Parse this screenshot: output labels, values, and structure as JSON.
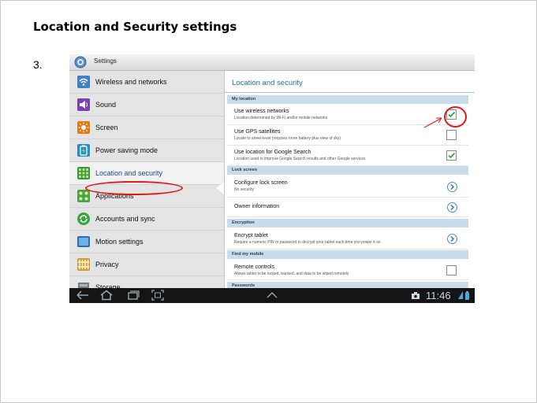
{
  "slide": {
    "title": "Location and Security settings",
    "step": "3."
  },
  "tablet": {
    "header_title": "Settings",
    "sidebar": {
      "items": [
        {
          "label": "Wireless and networks",
          "icon": "wifi-icon"
        },
        {
          "label": "Sound",
          "icon": "speaker-icon"
        },
        {
          "label": "Screen",
          "icon": "brightness-icon"
        },
        {
          "label": "Power saving mode",
          "icon": "power-saving-icon"
        },
        {
          "label": "Location and security",
          "icon": "location-security-icon"
        },
        {
          "label": "Applications",
          "icon": "applications-icon"
        },
        {
          "label": "Accounts and sync",
          "icon": "sync-icon"
        },
        {
          "label": "Motion settings",
          "icon": "motion-icon"
        },
        {
          "label": "Privacy",
          "icon": "privacy-icon"
        },
        {
          "label": "Storage",
          "icon": "storage-icon"
        }
      ],
      "active_index": 4
    },
    "panel": {
      "title": "Location and security",
      "sections": {
        "my_location": "My location",
        "lock_screen": "Lock screen",
        "encryption": "Encryption",
        "find_my_mobile": "Find my mobile",
        "passwords": "Passwords"
      },
      "rows": {
        "wireless": {
          "title": "Use wireless networks",
          "sub": "Location determined by Wi-Fi and/or mobile networks",
          "checked": true
        },
        "gps": {
          "title": "Use GPS satellites",
          "sub": "Locate to street-level (requires more battery plus view of sky)",
          "checked": false
        },
        "google": {
          "title": "Use location for Google Search",
          "sub": "Location used to improve Google Search results and other Google services",
          "checked": true
        },
        "configure_lock": {
          "title": "Configure lock screen",
          "sub": "No security"
        },
        "owner": {
          "title": "Owner information"
        },
        "encrypt": {
          "title": "Encrypt tablet",
          "sub": "Require a numeric PIN or password to decrypt your tablet each time you power it on"
        },
        "remote": {
          "title": "Remote controls",
          "sub": "Allows tablet to be locked, tracked, and data to be wiped remotely",
          "checked": false
        }
      }
    },
    "status": {
      "time": "11:46"
    }
  },
  "colors": {
    "accent_blue": "#1e6fa8",
    "section_bg": "#c8dcea",
    "annotation_red": "#e01818",
    "check_green": "#3aa640"
  }
}
